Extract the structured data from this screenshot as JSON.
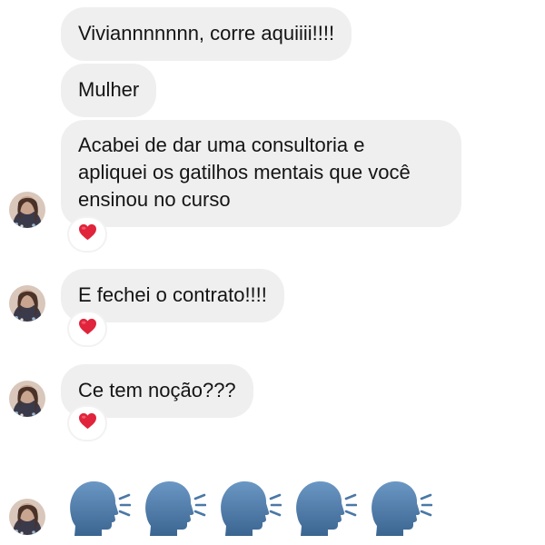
{
  "colors": {
    "bubble_bg": "#efefef",
    "heart": "#e0243b",
    "head": "#4a78a6",
    "text": "#141414"
  },
  "messages": [
    {
      "text": "Viviannnnnnn, corre aquiiii!!!!"
    },
    {
      "text": "Mulher"
    },
    {
      "text": "Acabei de dar uma consultoria e\napliquei os gatilhos mentais que você\nensinou no curso",
      "reaction": "heart-icon"
    },
    {
      "text": "E fechei o contrato!!!!",
      "reaction": "heart-icon"
    },
    {
      "text": "Ce tem noção???",
      "reaction": "heart-icon"
    },
    {
      "emoji": "speaking-head-icon",
      "count": 5
    }
  ],
  "icons": {
    "avatar": "avatar-photo",
    "reaction": "heart-icon",
    "emoji": "speaking-head-icon"
  }
}
